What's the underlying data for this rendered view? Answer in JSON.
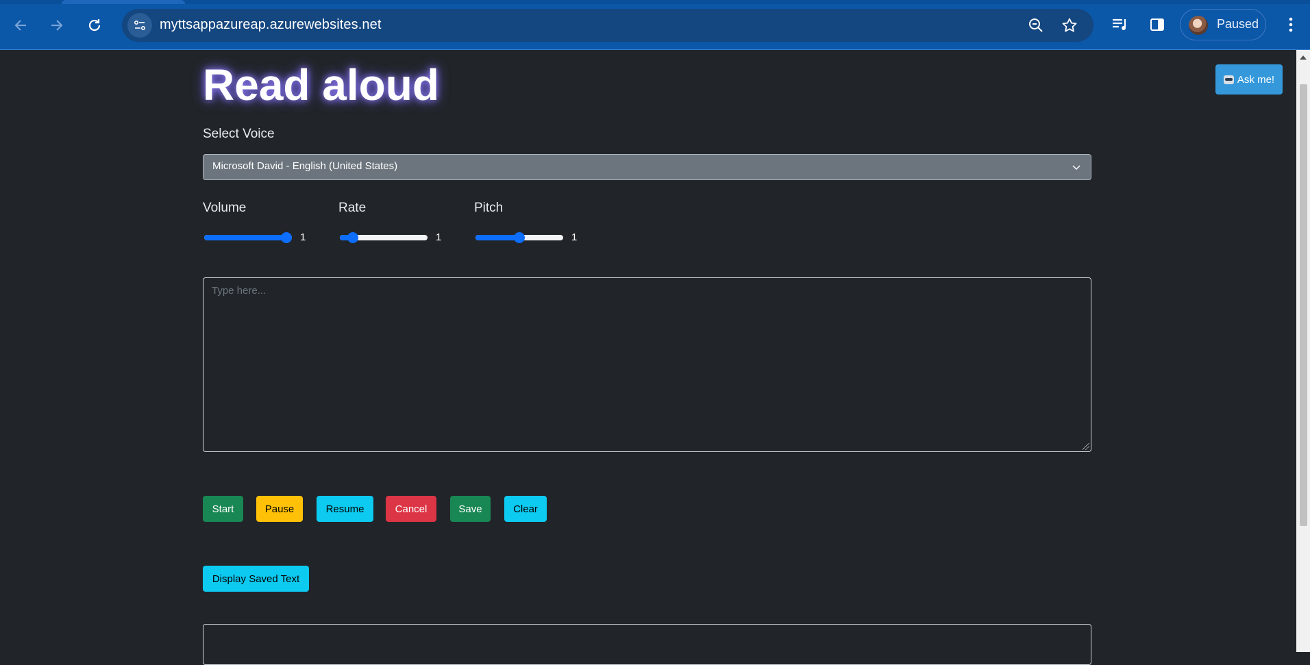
{
  "browser": {
    "url": "myttsappazureap.azurewebsites.net",
    "profile_label": "Paused",
    "icons": [
      "back-icon",
      "forward-icon",
      "reload-icon",
      "site-info-icon",
      "zoom-icon",
      "bookmark-star-icon",
      "media-controls-icon",
      "side-panel-icon",
      "menu-icon"
    ]
  },
  "app": {
    "title": "Read aloud",
    "ask_button": "Ask me!",
    "voice_label": "Select Voice",
    "voice_selected": "Microsoft David - English (United States)",
    "sliders": {
      "volume": {
        "label": "Volume",
        "value": "1",
        "level": 1.0
      },
      "rate": {
        "label": "Rate",
        "value": "1",
        "level": 0.1
      },
      "pitch": {
        "label": "Pitch",
        "value": "1",
        "level": 0.5
      }
    },
    "textarea_placeholder": "Type here...",
    "buttons": {
      "start": "Start",
      "pause": "Pause",
      "resume": "Resume",
      "cancel": "Cancel",
      "save": "Save",
      "clear": "Clear"
    },
    "display_saved": "Display Saved Text"
  },
  "colors": {
    "page_bg": "#212529",
    "chrome_bg": "#0b57a8",
    "primary": "#0d6efd",
    "success": "#198754",
    "warning": "#ffc107",
    "info": "#0dcaf0",
    "danger": "#dc3545",
    "ask_bg": "#3498db"
  }
}
